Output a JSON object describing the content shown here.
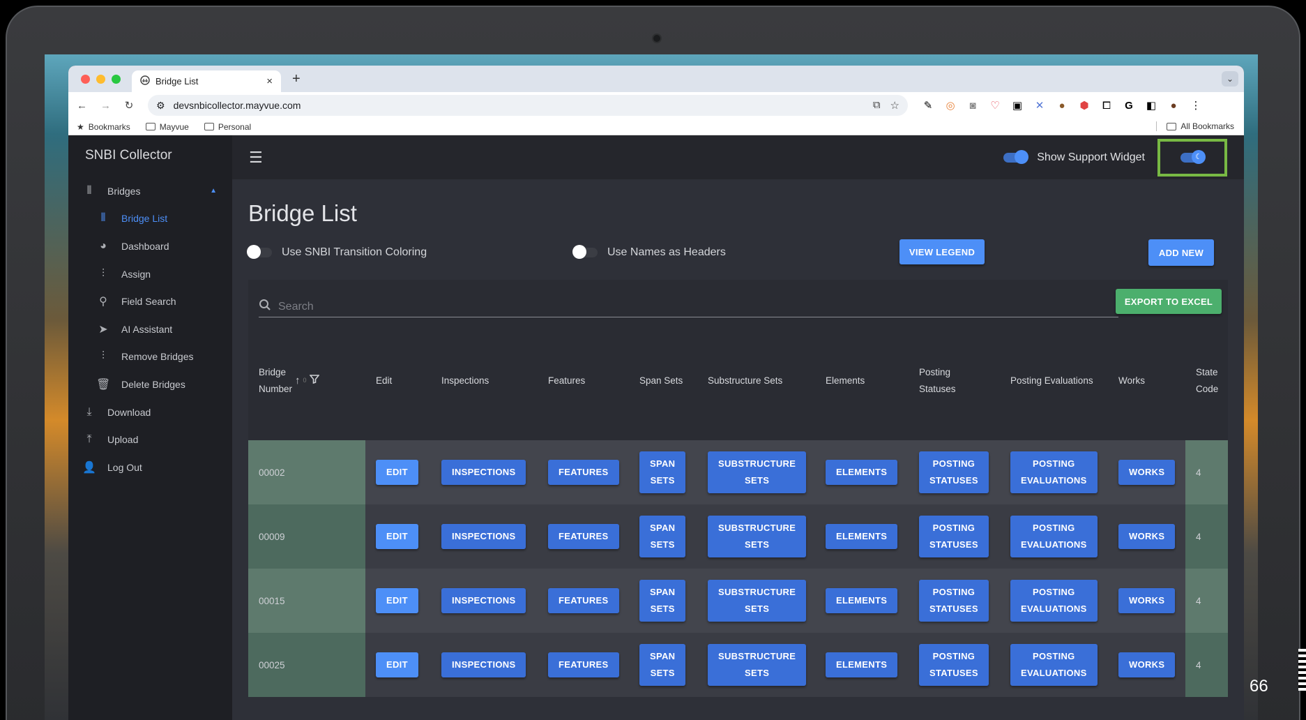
{
  "browser": {
    "tab_title": "Bridge List",
    "tab_close": "×",
    "new_tab": "+",
    "url": "devsnbicollector.mayvue.com",
    "bookmarks": [
      "Bookmarks",
      "Mayvue",
      "Personal"
    ],
    "all_bookmarks": "All Bookmarks"
  },
  "app": {
    "brand": "SNBI Collector",
    "support_widget_label": "Show Support Widget"
  },
  "sidebar": {
    "items": [
      {
        "label": "Bridges",
        "icon": "bridge-icon",
        "level": 0
      },
      {
        "label": "Bridge List",
        "icon": "bridge-list-icon",
        "level": 1,
        "active": true
      },
      {
        "label": "Dashboard",
        "icon": "pie-chart-icon",
        "level": 1
      },
      {
        "label": "Assign",
        "icon": "assign-icon",
        "level": 1
      },
      {
        "label": "Field Search",
        "icon": "search-icon",
        "level": 1
      },
      {
        "label": "AI Assistant",
        "icon": "send-icon",
        "level": 1
      },
      {
        "label": "Remove Bridges",
        "icon": "remove-icon",
        "level": 1
      },
      {
        "label": "Delete Bridges",
        "icon": "trash-icon",
        "level": 1
      },
      {
        "label": "Download",
        "icon": "download-icon",
        "level": 0
      },
      {
        "label": "Upload",
        "icon": "upload-icon",
        "level": 0
      },
      {
        "label": "Log Out",
        "icon": "user-icon",
        "level": 0
      }
    ]
  },
  "page": {
    "title": "Bridge List",
    "transition_coloring_label": "Use SNBI Transition Coloring",
    "names_headers_label": "Use Names as Headers",
    "view_legend": "VIEW LEGEND",
    "add_new": "ADD NEW",
    "export_excel": "EXPORT TO EXCEL",
    "search_placeholder": "Search"
  },
  "table": {
    "headers": {
      "bridge_number": [
        "Bridge",
        "Number"
      ],
      "edit": "Edit",
      "inspections": "Inspections",
      "features": "Features",
      "span_sets": "Span Sets",
      "substructure_sets": "Substructure Sets",
      "elements": "Elements",
      "posting_statuses": [
        "Posting",
        "Statuses"
      ],
      "posting_evaluations": "Posting Evaluations",
      "works": "Works",
      "state_code": [
        "State",
        "Code"
      ]
    },
    "sort_count": "0",
    "buttons": {
      "edit": "EDIT",
      "inspections": "INSPECTIONS",
      "features": "FEATURES",
      "span_sets": [
        "SPAN",
        "SETS"
      ],
      "substructure_sets": [
        "SUBSTRUCTURE",
        "SETS"
      ],
      "elements": "ELEMENTS",
      "posting_statuses": [
        "POSTING",
        "STATUSES"
      ],
      "posting_evaluations": [
        "POSTING",
        "EVALUATIONS"
      ],
      "works": "WORKS"
    },
    "rows": [
      {
        "bridge_number": "00002",
        "state_code": "4"
      },
      {
        "bridge_number": "00009",
        "state_code": "4"
      },
      {
        "bridge_number": "00015",
        "state_code": "4"
      },
      {
        "bridge_number": "00025",
        "state_code": "4"
      }
    ]
  },
  "slide_number": "66",
  "colors": {
    "accent": "#4d8ff7",
    "primary_button": "#3a6fd8",
    "export_green": "#4caf6d",
    "highlight_box": "#78b944"
  }
}
